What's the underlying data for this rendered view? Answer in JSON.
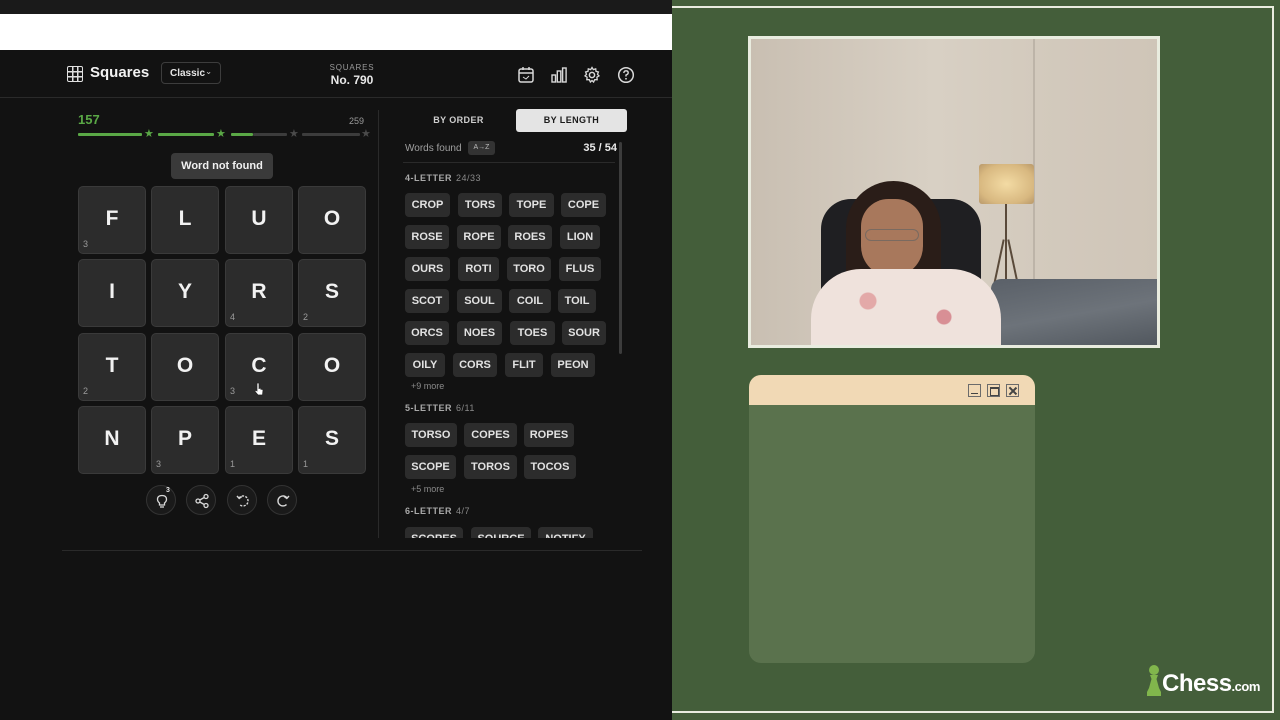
{
  "app": {
    "name": "Squares",
    "mode": "Classic",
    "puzzle_label": "SQUARES",
    "puzzle_number": "No. 790"
  },
  "icons": [
    "calendar-icon",
    "stats-icon",
    "gear-icon",
    "help-icon",
    "hint-icon",
    "share-icon",
    "reset-icon",
    "rotate-icon"
  ],
  "score": {
    "current": "157",
    "max": "259",
    "progress_fraction": 0.61
  },
  "toast": "Word not found",
  "board": [
    {
      "letter": "F",
      "count": "3"
    },
    {
      "letter": "L",
      "count": ""
    },
    {
      "letter": "U",
      "count": ""
    },
    {
      "letter": "O",
      "count": ""
    },
    {
      "letter": "I",
      "count": ""
    },
    {
      "letter": "Y",
      "count": ""
    },
    {
      "letter": "R",
      "count": "4"
    },
    {
      "letter": "S",
      "count": "2"
    },
    {
      "letter": "T",
      "count": "2"
    },
    {
      "letter": "O",
      "count": ""
    },
    {
      "letter": "C",
      "count": "3"
    },
    {
      "letter": "O",
      "count": ""
    },
    {
      "letter": "N",
      "count": ""
    },
    {
      "letter": "P",
      "count": "3"
    },
    {
      "letter": "E",
      "count": "1"
    },
    {
      "letter": "S",
      "count": "1"
    }
  ],
  "hint_badge": "3",
  "tabs": {
    "by_order": "BY ORDER",
    "by_length": "BY LENGTH",
    "active": "BY LENGTH"
  },
  "words_found_label": "Words found",
  "sort_label": "A→Z",
  "words_found_count": "35 / 54",
  "sections": [
    {
      "title": "4-LETTER",
      "count": "24/33",
      "words": [
        "CROP",
        "TORS",
        "TOPE",
        "COPE",
        "ROSE",
        "ROPE",
        "ROES",
        "LION",
        "OURS",
        "ROTI",
        "TORO",
        "FLUS",
        "SCOT",
        "SOUL",
        "COIL",
        "TOIL",
        "ORCS",
        "NOES",
        "TOES",
        "SOUR",
        "OILY",
        "CORS",
        "FLIT",
        "PEON"
      ],
      "more": "+9 more"
    },
    {
      "title": "5-LETTER",
      "count": "6/11",
      "words": [
        "TORSO",
        "COPES",
        "ROPES",
        "SCOPE",
        "TOROS",
        "TOCOS"
      ],
      "more": "+5 more"
    },
    {
      "title": "6-LETTER",
      "count": "4/7",
      "words": [
        "SCOPES",
        "SOURCE",
        "NOTIFY"
      ]
    }
  ],
  "branding": {
    "logo_main": "Chess",
    "logo_suffix": ".com"
  }
}
